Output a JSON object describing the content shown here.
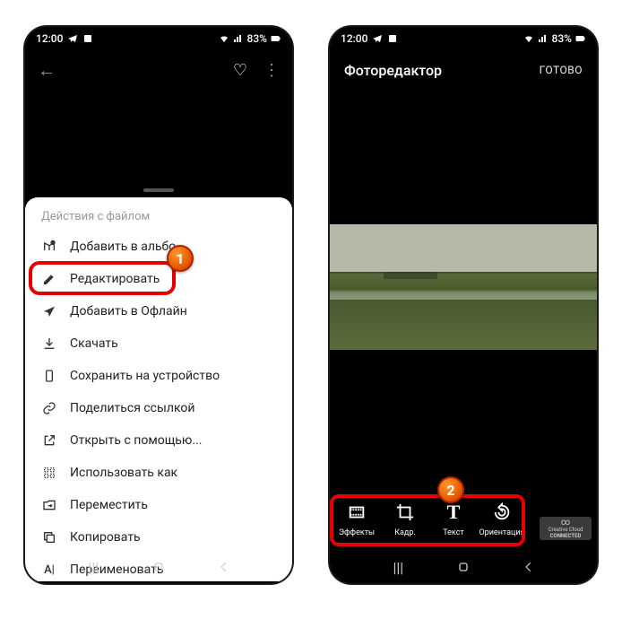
{
  "status": {
    "time": "12:00",
    "battery": "83%"
  },
  "left": {
    "sheet_title": "Действия с файлом",
    "items": [
      {
        "icon": "add-album",
        "label": "Добавить в альбо..."
      },
      {
        "icon": "edit",
        "label": "Редактировать"
      },
      {
        "icon": "offline",
        "label": "Добавить в Офлайн"
      },
      {
        "icon": "download",
        "label": "Скачать"
      },
      {
        "icon": "save-device",
        "label": "Сохранить на устройство"
      },
      {
        "icon": "link",
        "label": "Поделиться ссылкой"
      },
      {
        "icon": "open-with",
        "label": "Открыть с помощью..."
      },
      {
        "icon": "use-as",
        "label": "Использовать как"
      },
      {
        "icon": "move",
        "label": "Переместить"
      },
      {
        "icon": "copy",
        "label": "Копировать"
      },
      {
        "icon": "rename",
        "label": "Переименовать"
      }
    ],
    "badge1": "1"
  },
  "right": {
    "title": "Фоторедактор",
    "done": "ГОТОВО",
    "tools": [
      {
        "label": "Эффекты"
      },
      {
        "label": "Кадр."
      },
      {
        "label": "Текст"
      },
      {
        "label": "Ориентация"
      }
    ],
    "cc": {
      "line1": "Creative Cloud",
      "line2": "CONNECTED"
    },
    "badge2": "2"
  }
}
